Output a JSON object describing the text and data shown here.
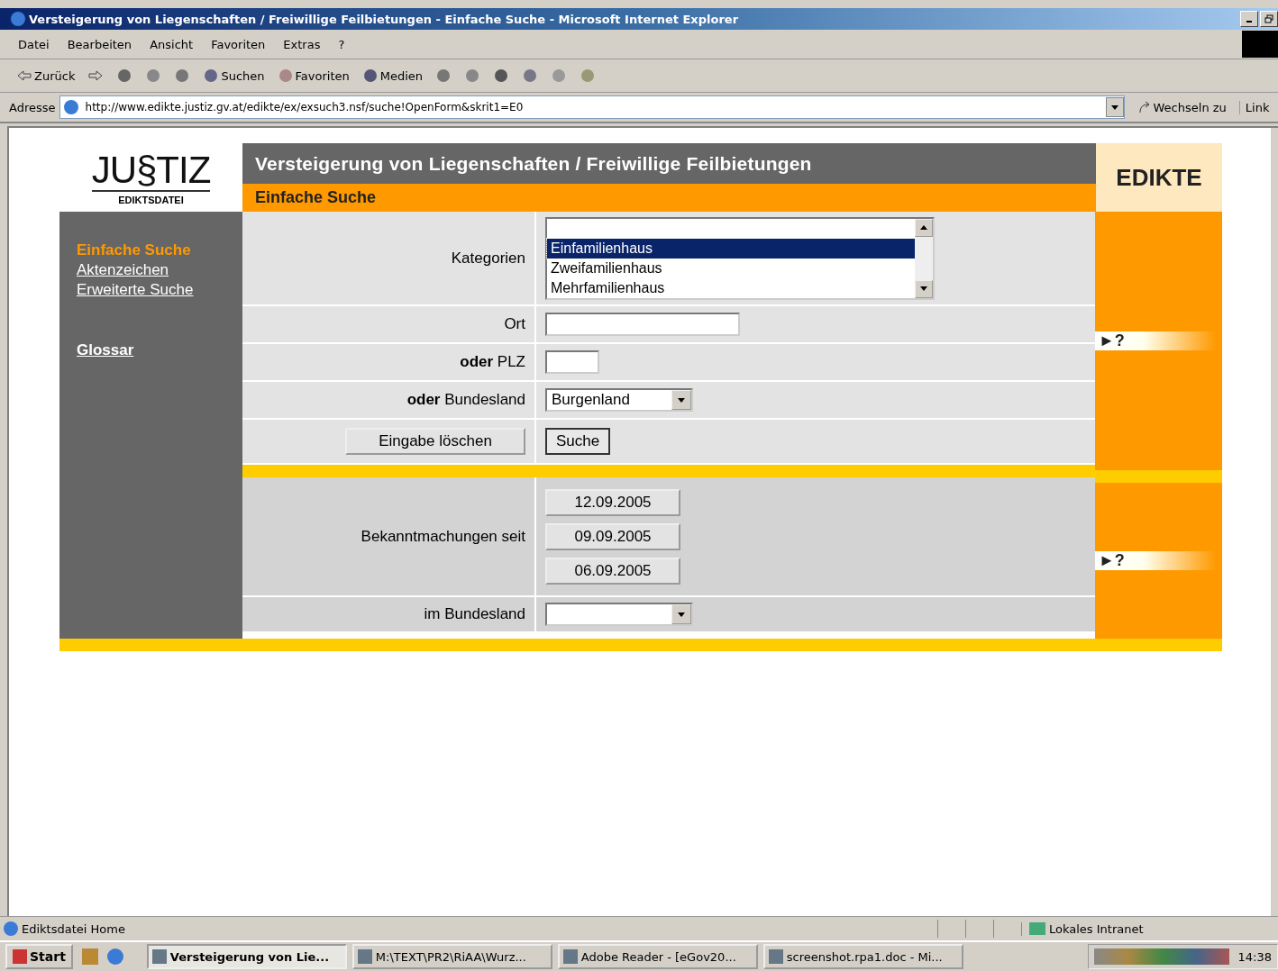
{
  "window": {
    "title": "Versteigerung von Liegenschaften / Freiwillige Feilbietungen - Einfache Suche - Microsoft Internet Explorer"
  },
  "menu": [
    "Datei",
    "Bearbeiten",
    "Ansicht",
    "Favoriten",
    "Extras",
    "?"
  ],
  "toolbar": [
    {
      "kind": "back",
      "label": "Zurück"
    },
    {
      "kind": "forward"
    },
    {
      "kind": "stop"
    },
    {
      "kind": "refresh"
    },
    {
      "kind": "home"
    },
    {
      "kind": "search",
      "label": "Suchen"
    },
    {
      "kind": "favorites",
      "label": "Favoriten"
    },
    {
      "kind": "media",
      "label": "Medien"
    },
    {
      "kind": "history"
    },
    {
      "kind": "mail"
    },
    {
      "kind": "print"
    },
    {
      "kind": "edit"
    },
    {
      "kind": "discuss"
    },
    {
      "kind": "messenger"
    }
  ],
  "address": {
    "label": "Adresse",
    "url": "http://www.edikte.justiz.gv.at/edikte/ex/exsuch3.nsf/suche!OpenForm&skrit1=E0",
    "go": "Wechseln zu",
    "links": "Link"
  },
  "page": {
    "logo": {
      "text": "JU§TIZ",
      "subtitle": "EDIKTSDATEI"
    },
    "header": {
      "title": "Versteigerung von Liegenschaften / Freiwillige Feilbietungen",
      "subtitle": "Einfache Suche"
    },
    "badge": "EDIKTE",
    "sidebar": {
      "items": [
        {
          "label": "Einfache Suche",
          "selected": true
        },
        {
          "label": "Aktenzeichen",
          "selected": false
        },
        {
          "label": "Erweiterte Suche",
          "selected": false
        }
      ],
      "glossary": "Glossar"
    },
    "form": {
      "categories": {
        "label": "Kategorien",
        "options": [
          {
            "label": "Einfamilienhaus",
            "selected": true
          },
          {
            "label": "Zweifamilienhaus",
            "selected": false
          },
          {
            "label": "Mehrfamilienhaus",
            "selected": false
          }
        ]
      },
      "place": {
        "label": "Ort"
      },
      "zip": {
        "label": "**oder** PLZ"
      },
      "state": {
        "label": "**oder** Bundesland",
        "value": "Burgenland"
      },
      "reset": "Eingabe löschen",
      "submit": "Suche",
      "published": {
        "label": "Bekanntmachungen seit",
        "dates": [
          "12.09.2005",
          "09.09.2005",
          "06.09.2005"
        ]
      },
      "published_state": {
        "label": "im Bundesland"
      }
    },
    "help": [
      "►?",
      "►?"
    ]
  },
  "status": {
    "text": "Ediktsdatei Home",
    "zone": "Lokales Intranet"
  },
  "taskbar": {
    "start": "Start",
    "tasks": [
      {
        "label": "Versteigerung von Lie...",
        "selected": true
      },
      {
        "label": "M:\\TEXT\\PR2\\RiAA\\Wurz...",
        "selected": false
      },
      {
        "label": "Adobe Reader - [eGov20...",
        "selected": false
      },
      {
        "label": "screenshot.rpa1.doc - Mi...",
        "selected": false
      }
    ],
    "clock": "14:38"
  }
}
